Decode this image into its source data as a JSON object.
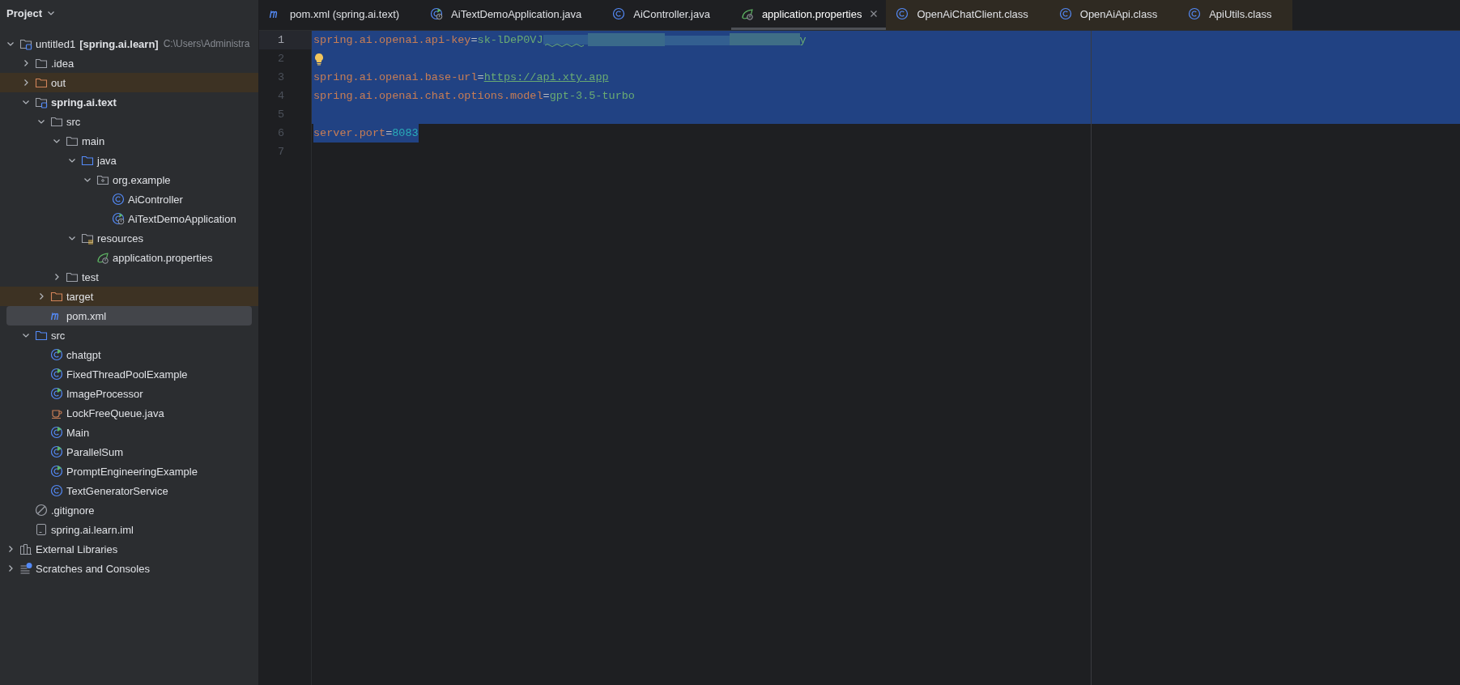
{
  "sidebar": {
    "title": "Project",
    "tree": [
      {
        "label": "untitled1",
        "module": "[spring.ai.learn]",
        "path": "C:\\Users\\Administra",
        "kind": "module",
        "expanded": true,
        "selected": false,
        "excluded": false,
        "children": [
          {
            "label": ".idea",
            "kind": "folder",
            "expanded": false,
            "selected": false,
            "excluded": false
          },
          {
            "label": "out",
            "kind": "folder",
            "expanded": false,
            "selected": false,
            "excluded": true
          },
          {
            "label": "spring.ai.text",
            "kind": "module",
            "bold": true,
            "expanded": true,
            "selected": false,
            "excluded": false,
            "children": [
              {
                "label": "src",
                "kind": "folder",
                "expanded": true,
                "selected": false,
                "excluded": false,
                "children": [
                  {
                    "label": "main",
                    "kind": "folder",
                    "expanded": true,
                    "selected": false,
                    "excluded": false,
                    "children": [
                      {
                        "label": "java",
                        "kind": "source",
                        "expanded": true,
                        "selected": false,
                        "excluded": false,
                        "children": [
                          {
                            "label": "org.example",
                            "kind": "package",
                            "expanded": true,
                            "selected": false,
                            "excluded": false,
                            "children": [
                              {
                                "label": "AiController",
                                "kind": "class",
                                "selected": false,
                                "excluded": false
                              },
                              {
                                "label": "AiTextDemoApplication",
                                "kind": "springclass",
                                "selected": false,
                                "excluded": false
                              }
                            ]
                          }
                        ]
                      },
                      {
                        "label": "resources",
                        "kind": "resources",
                        "expanded": true,
                        "selected": false,
                        "excluded": false,
                        "children": [
                          {
                            "label": "application.properties",
                            "kind": "properties",
                            "selected": false,
                            "excluded": false
                          }
                        ]
                      }
                    ]
                  },
                  {
                    "label": "test",
                    "kind": "folder",
                    "expanded": false,
                    "selected": false,
                    "excluded": false
                  }
                ]
              },
              {
                "label": "target",
                "kind": "folder",
                "expanded": false,
                "selected": false,
                "excluded": true
              },
              {
                "label": "pom.xml",
                "kind": "maven",
                "selected": true,
                "excluded": false
              }
            ]
          },
          {
            "label": "src",
            "kind": "source",
            "expanded": true,
            "selected": false,
            "excluded": false,
            "children": [
              {
                "label": "chatgpt",
                "kind": "mainclass",
                "selected": false,
                "excluded": false
              },
              {
                "label": "FixedThreadPoolExample",
                "kind": "mainclass",
                "selected": false,
                "excluded": false
              },
              {
                "label": "ImageProcessor",
                "kind": "mainclass",
                "selected": false,
                "excluded": false
              },
              {
                "label": "LockFreeQueue.java",
                "kind": "java",
                "selected": false,
                "excluded": false
              },
              {
                "label": "Main",
                "kind": "mainclass",
                "selected": false,
                "excluded": false
              },
              {
                "label": "ParallelSum",
                "kind": "mainclass",
                "selected": false,
                "excluded": false
              },
              {
                "label": "PromptEngineeringExample",
                "kind": "mainclass",
                "selected": false,
                "excluded": false
              },
              {
                "label": "TextGeneratorService",
                "kind": "class",
                "selected": false,
                "excluded": false
              }
            ]
          },
          {
            "label": ".gitignore",
            "kind": "ignore",
            "selected": false,
            "excluded": false
          },
          {
            "label": "spring.ai.learn.iml",
            "kind": "iml",
            "selected": false,
            "excluded": false
          }
        ]
      },
      {
        "label": "External Libraries",
        "kind": "libraries",
        "expanded": false,
        "selected": false,
        "excluded": false
      },
      {
        "label": "Scratches and Consoles",
        "kind": "scratches",
        "expanded": false,
        "selected": false,
        "excluded": false
      }
    ]
  },
  "tabs": [
    {
      "label": "pom.xml (spring.ai.text)",
      "kind": "maven",
      "library": false,
      "selected": false
    },
    {
      "label": "AiTextDemoApplication.java",
      "kind": "springclass",
      "library": false,
      "selected": false
    },
    {
      "label": "AiController.java",
      "kind": "class",
      "library": false,
      "selected": false
    },
    {
      "label": "application.properties",
      "kind": "properties",
      "library": false,
      "selected": true
    },
    {
      "label": "OpenAiChatClient.class",
      "kind": "class",
      "library": true,
      "selected": false
    },
    {
      "label": "OpenAiApi.class",
      "kind": "class",
      "library": true,
      "selected": false
    },
    {
      "label": "ApiUtils.class",
      "kind": "class",
      "library": true,
      "selected": false
    }
  ],
  "editor": {
    "lines": [
      {
        "number": "1",
        "current": true,
        "selected": true,
        "segments": [
          {
            "kind": "key",
            "text": "spring.ai.openai.api-key"
          },
          {
            "kind": "eq",
            "text": "="
          },
          {
            "kind": "value",
            "text": "sk-lDeP0VJ"
          },
          {
            "kind": "redacted"
          },
          {
            "kind": "value",
            "text": "y"
          }
        ]
      },
      {
        "number": "2",
        "current": false,
        "selected": true,
        "hint": true
      },
      {
        "number": "3",
        "current": false,
        "selected": true,
        "segments": [
          {
            "kind": "key",
            "text": "spring.ai.openai.base-url"
          },
          {
            "kind": "eq",
            "text": "="
          },
          {
            "kind": "link",
            "text": "https://api.xty.app"
          }
        ]
      },
      {
        "number": "4",
        "current": false,
        "selected": true,
        "segments": [
          {
            "kind": "key",
            "text": "spring.ai.openai.chat.options.model"
          },
          {
            "kind": "eq",
            "text": "="
          },
          {
            "kind": "value",
            "text": "gpt-3.5-turbo"
          }
        ]
      },
      {
        "number": "5",
        "current": false,
        "selected": true
      },
      {
        "number": "6",
        "current": false,
        "selected": true,
        "segments": [
          {
            "kind": "key",
            "text": "server.port"
          },
          {
            "kind": "eq",
            "text": "="
          },
          {
            "kind": "number",
            "text": "8083"
          }
        ]
      },
      {
        "number": "7",
        "current": false,
        "selected": false
      }
    ]
  }
}
